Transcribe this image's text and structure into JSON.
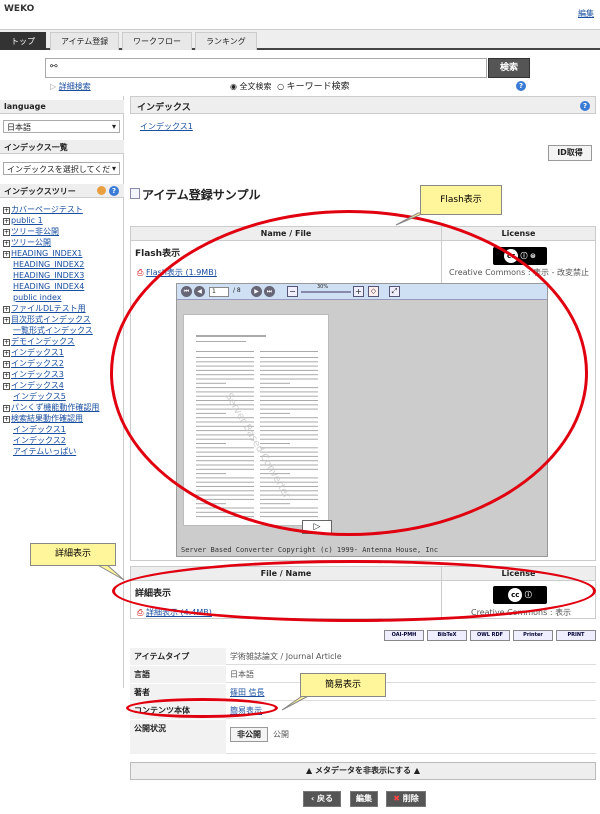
{
  "header": {
    "logo": "WEKO",
    "edit_link": "編集"
  },
  "tabs": [
    "トップ",
    "アイテム登録",
    "ワークフロー",
    "ランキング"
  ],
  "search": {
    "button": "検索",
    "advanced": "詳細検索",
    "option_fulltext": "全文検索",
    "option_keyword": "キーワード検索",
    "help": "?"
  },
  "sidebar": {
    "language_header": "language",
    "language_value": "日本語",
    "index_list_header": "インデックス一覧",
    "index_select": "インデックスを選択してくだ",
    "tree_header": "インデックスツリー",
    "tree": [
      {
        "label": "カバーページテスト",
        "box": "+",
        "indent": 0
      },
      {
        "label": "public 1",
        "box": "+",
        "indent": 0
      },
      {
        "label": "ツリー非公開",
        "box": "+",
        "indent": 0
      },
      {
        "label": "ツリー公開",
        "box": "+",
        "indent": 0
      },
      {
        "label": "HEADING_INDEX1",
        "box": "+",
        "indent": 0
      },
      {
        "label": "HEADING_INDEX2",
        "box": "",
        "indent": 1
      },
      {
        "label": "HEADING_INDEX3",
        "box": "",
        "indent": 1
      },
      {
        "label": "HEADING_INDEX4",
        "box": "",
        "indent": 1
      },
      {
        "label": "public index",
        "box": "",
        "indent": 1
      },
      {
        "label": "ファイルDLテスト用",
        "box": "+",
        "indent": 0
      },
      {
        "label": "目次形式インデックス",
        "box": "+",
        "indent": 0
      },
      {
        "label": "一覧形式インデックス",
        "box": "",
        "indent": 1
      },
      {
        "label": "デモインデックス",
        "box": "+",
        "indent": 0
      },
      {
        "label": "インデックス1",
        "box": "+",
        "indent": 0
      },
      {
        "label": "インデックス2",
        "box": "+",
        "indent": 0
      },
      {
        "label": "インデックス3",
        "box": "+",
        "indent": 0
      },
      {
        "label": "インデックス4",
        "box": "+",
        "indent": 0
      },
      {
        "label": "インデックス5",
        "box": "",
        "indent": 1
      },
      {
        "label": "パンくず機能動作確認用",
        "box": "+",
        "indent": 0
      },
      {
        "label": "検索結果動作確認用",
        "box": "+",
        "indent": 0
      },
      {
        "label": "インデックス1",
        "box": "",
        "indent": 1
      },
      {
        "label": "インデックス2",
        "box": "",
        "indent": 1
      },
      {
        "label": "アイテムいっぱい",
        "box": "",
        "indent": 1
      }
    ]
  },
  "main": {
    "index_header": "インデックス",
    "index_link": "インデックス1",
    "id_button": "ID取得",
    "item_title": "アイテム登録サンプル",
    "file_table1": {
      "col_name": "Name / File",
      "col_license": "License",
      "title": "Flash表示",
      "file_link": "Flash表示 (1.9MB)",
      "license_text": "Creative Commons : 表示 - 改変禁止"
    },
    "viewer": {
      "page_input": "1",
      "page_total": "/ 8",
      "zoom": "30%",
      "footer": "Server Based Converter Copyright (c) 1999- Antenna House, Inc"
    },
    "file_table2": {
      "col_name": "File / Name",
      "col_license": "License",
      "title": "詳細表示",
      "file_link": "詳細表示 (4.4MB)",
      "license_text": "Creative Commons : 表示"
    },
    "badges": [
      "OAI-PMH",
      "BibTeX",
      "OWL RDF",
      "Printer",
      "PRINT"
    ],
    "meta": [
      {
        "label": "アイテムタイプ",
        "value": "学術雑誌論文 / Journal Article",
        "link": false
      },
      {
        "label": "言語",
        "value": "日本語",
        "link": false
      },
      {
        "label": "著者",
        "value": "篠田 信長",
        "link": true
      },
      {
        "label": "コンテンツ本体",
        "value": "簡易表示",
        "link": true
      }
    ],
    "public_label": "公開状況",
    "private_button": "非公開",
    "public_text": "公開",
    "toggle_meta": "▲ メタデータを非表示にする ▲",
    "actions": {
      "back": "戻る",
      "edit": "編集",
      "delete": "削除"
    }
  },
  "annotations": {
    "flash": "Flash表示",
    "detail": "詳細表示",
    "simple": "簡易表示"
  },
  "colors": {
    "annotation_red": "#e0000f",
    "callout_yellow": "#fff59a",
    "link_blue": "#1a4fa0"
  }
}
